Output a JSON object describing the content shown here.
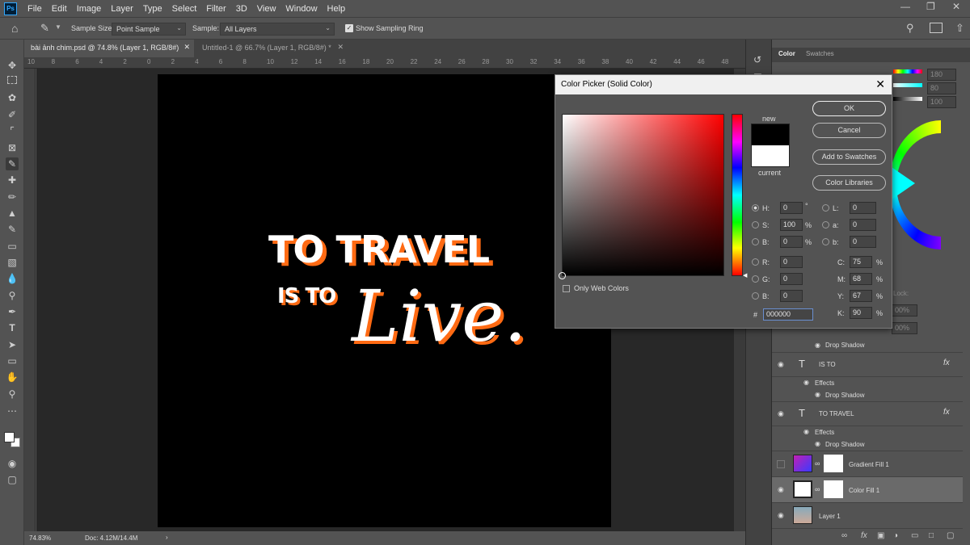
{
  "app": {
    "logo": "Ps"
  },
  "menu": [
    "File",
    "Edit",
    "Image",
    "Layer",
    "Type",
    "Select",
    "Filter",
    "3D",
    "View",
    "Window",
    "Help"
  ],
  "options_bar": {
    "sample_size_label": "Sample Size:",
    "sample_size_value": "Point Sample",
    "sample_label": "Sample:",
    "sample_value": "All Layers",
    "show_sampling_ring": "Show Sampling Ring",
    "show_sampling_ring_checked": true
  },
  "tabs": [
    {
      "label": "bài ảnh chim.psd @ 74.8% (Layer 1, RGB/8#)",
      "active": true
    },
    {
      "label": "Untitled-1 @ 66.7% (Layer 1, RGB/8#) *",
      "active": false
    }
  ],
  "ruler_ticks": [
    "10",
    "8",
    "6",
    "4",
    "2",
    "0",
    "2",
    "4",
    "6",
    "8",
    "10",
    "12",
    "14",
    "16",
    "18",
    "20",
    "22",
    "24",
    "26",
    "28",
    "30",
    "32",
    "34",
    "36",
    "38",
    "40",
    "42",
    "44",
    "46",
    "48"
  ],
  "canvas_art": {
    "line1": "TO TRAVEL",
    "line2": "IS TO",
    "line3": "Live."
  },
  "status": {
    "zoom": "74.83%",
    "doc": "Doc: 4.12M/14.4M"
  },
  "right_panel": {
    "tabs": [
      "Color",
      "Swatches"
    ],
    "color_values": [
      "180",
      "80",
      "100"
    ],
    "layers": [
      {
        "name": "Drop Shadow",
        "type": "effect"
      },
      {
        "name": "IS TO",
        "type": "text",
        "fx": true
      },
      {
        "name": "Effects",
        "type": "effects"
      },
      {
        "name": "Drop Shadow",
        "type": "effect"
      },
      {
        "name": "TO TRAVEL",
        "type": "text",
        "fx": true
      },
      {
        "name": "Effects",
        "type": "effects"
      },
      {
        "name": "Drop Shadow",
        "type": "effect"
      },
      {
        "name": "Gradient Fill 1",
        "type": "fill"
      },
      {
        "name": "Color Fill 1",
        "type": "fill",
        "selected": true
      },
      {
        "name": "Layer 1",
        "type": "image"
      }
    ],
    "layer_partials": {
      "lock": "Lock:",
      "opacity": "00%",
      "fill": "00%"
    }
  },
  "color_picker": {
    "title": "Color Picker (Solid Color)",
    "new_label": "new",
    "current_label": "current",
    "buttons": {
      "ok": "OK",
      "cancel": "Cancel",
      "add": "Add to Swatches",
      "libs": "Color Libraries"
    },
    "only_web_colors": "Only Web Colors",
    "hsb": {
      "H": "0",
      "S": "100",
      "B": "0"
    },
    "rgb": {
      "R": "0",
      "G": "0",
      "B": "0"
    },
    "lab": {
      "L": "0",
      "a": "0",
      "b": "0"
    },
    "cmyk": {
      "C": "75",
      "M": "68",
      "Y": "67",
      "K": "90"
    },
    "hex": "000000",
    "units": {
      "degree": "°",
      "percent": "%"
    },
    "labels": {
      "H": "H:",
      "S": "S:",
      "B": "B:",
      "R": "R:",
      "G": "G:",
      "Bb": "B:",
      "L": "L:",
      "a": "a:",
      "b": "b:",
      "C": "C:",
      "M": "M:",
      "Y": "Y:",
      "K": "K:",
      "hash": "#"
    },
    "new_color": "#000000",
    "current_color": "#ffffff"
  },
  "colors": {
    "accent": "#ff6a13",
    "dialog_bg": "#535353",
    "canvas": "#000000"
  }
}
